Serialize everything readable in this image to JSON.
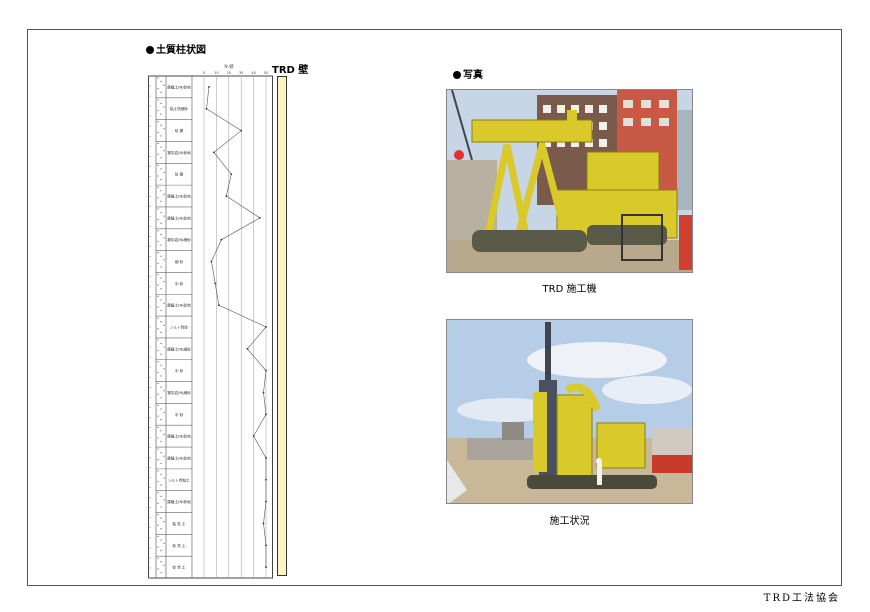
{
  "left_section": {
    "title": "土質柱状図",
    "trd_label": "TRD 壁",
    "scale_caption": "N 値",
    "scale_ticks": [
      "0",
      "10",
      "20",
      "30",
      "40",
      "50"
    ],
    "soil_layers": [
      {
        "label": "腐植土(N)砂地"
      },
      {
        "label": "粘土質細砂"
      },
      {
        "label": "砂 層"
      },
      {
        "label": "凝灰岩(N)砂地"
      },
      {
        "label": "砂 層"
      },
      {
        "label": "腐植土(N)砂地"
      },
      {
        "label": "腐植土(N)砂地"
      },
      {
        "label": "凝灰岩(N)細砂"
      },
      {
        "label": "細 砂"
      },
      {
        "label": "中 砂"
      },
      {
        "label": "腐植土(N)砂地"
      },
      {
        "label": "シルト質砂"
      },
      {
        "label": "腐植土(N)細砂"
      },
      {
        "label": "中 砂"
      },
      {
        "label": "凝灰岩(N)細砂"
      },
      {
        "label": "中 砂"
      },
      {
        "label": "腐植土(N)砂地"
      },
      {
        "label": "腐植土(N)砂地"
      },
      {
        "label": "シルト質粘土"
      },
      {
        "label": "腐植土(N)砂地"
      },
      {
        "label": "粘 性 土"
      },
      {
        "label": "砂 質 土"
      },
      {
        "label": "砂 質 土"
      }
    ],
    "n_values": [
      4,
      2,
      30,
      8,
      22,
      18,
      45,
      14,
      6,
      9,
      12,
      50,
      35,
      60,
      48,
      55,
      40,
      50,
      52,
      50,
      48,
      50,
      50
    ]
  },
  "right_section": {
    "title": "写真",
    "photo1_caption": "TRD 施工機",
    "photo2_caption": "施工状況"
  },
  "footer": "TRD工法協会",
  "colors": {
    "trd_wall_fill": "#fbf5c2",
    "machine_yellow": "#d9c92a",
    "sky": "#bcd0e8"
  }
}
